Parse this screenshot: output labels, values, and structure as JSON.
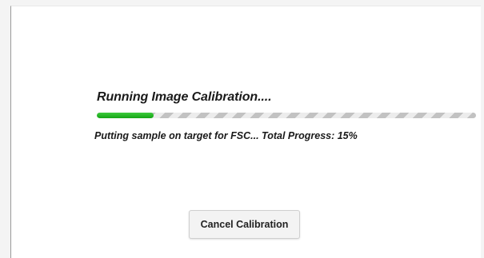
{
  "dialog": {
    "title": "Running Image Calibration....",
    "status_text": "Putting sample on target for FSC... Total Progress: 15%",
    "progress_fraction": 0.15,
    "cancel_label": "Cancel Calibration"
  },
  "colors": {
    "progress_fill": "#1fb51f",
    "progress_stripe": "#c2c2c2"
  }
}
